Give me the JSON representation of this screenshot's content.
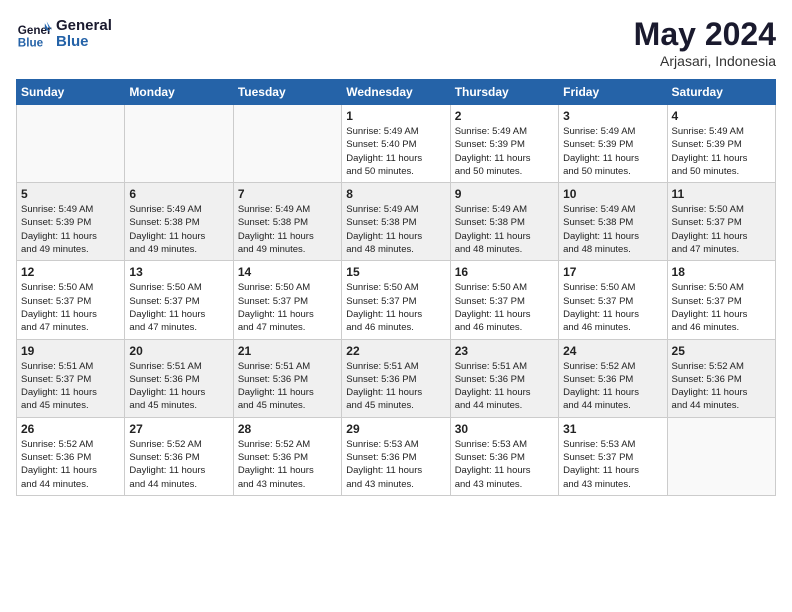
{
  "header": {
    "logo_line1": "General",
    "logo_line2": "Blue",
    "month": "May 2024",
    "location": "Arjasari, Indonesia"
  },
  "weekdays": [
    "Sunday",
    "Monday",
    "Tuesday",
    "Wednesday",
    "Thursday",
    "Friday",
    "Saturday"
  ],
  "weeks": [
    [
      {
        "day": "",
        "info": ""
      },
      {
        "day": "",
        "info": ""
      },
      {
        "day": "",
        "info": ""
      },
      {
        "day": "1",
        "info": "Sunrise: 5:49 AM\nSunset: 5:40 PM\nDaylight: 11 hours\nand 50 minutes."
      },
      {
        "day": "2",
        "info": "Sunrise: 5:49 AM\nSunset: 5:39 PM\nDaylight: 11 hours\nand 50 minutes."
      },
      {
        "day": "3",
        "info": "Sunrise: 5:49 AM\nSunset: 5:39 PM\nDaylight: 11 hours\nand 50 minutes."
      },
      {
        "day": "4",
        "info": "Sunrise: 5:49 AM\nSunset: 5:39 PM\nDaylight: 11 hours\nand 50 minutes."
      }
    ],
    [
      {
        "day": "5",
        "info": "Sunrise: 5:49 AM\nSunset: 5:39 PM\nDaylight: 11 hours\nand 49 minutes."
      },
      {
        "day": "6",
        "info": "Sunrise: 5:49 AM\nSunset: 5:38 PM\nDaylight: 11 hours\nand 49 minutes."
      },
      {
        "day": "7",
        "info": "Sunrise: 5:49 AM\nSunset: 5:38 PM\nDaylight: 11 hours\nand 49 minutes."
      },
      {
        "day": "8",
        "info": "Sunrise: 5:49 AM\nSunset: 5:38 PM\nDaylight: 11 hours\nand 48 minutes."
      },
      {
        "day": "9",
        "info": "Sunrise: 5:49 AM\nSunset: 5:38 PM\nDaylight: 11 hours\nand 48 minutes."
      },
      {
        "day": "10",
        "info": "Sunrise: 5:49 AM\nSunset: 5:38 PM\nDaylight: 11 hours\nand 48 minutes."
      },
      {
        "day": "11",
        "info": "Sunrise: 5:50 AM\nSunset: 5:37 PM\nDaylight: 11 hours\nand 47 minutes."
      }
    ],
    [
      {
        "day": "12",
        "info": "Sunrise: 5:50 AM\nSunset: 5:37 PM\nDaylight: 11 hours\nand 47 minutes."
      },
      {
        "day": "13",
        "info": "Sunrise: 5:50 AM\nSunset: 5:37 PM\nDaylight: 11 hours\nand 47 minutes."
      },
      {
        "day": "14",
        "info": "Sunrise: 5:50 AM\nSunset: 5:37 PM\nDaylight: 11 hours\nand 47 minutes."
      },
      {
        "day": "15",
        "info": "Sunrise: 5:50 AM\nSunset: 5:37 PM\nDaylight: 11 hours\nand 46 minutes."
      },
      {
        "day": "16",
        "info": "Sunrise: 5:50 AM\nSunset: 5:37 PM\nDaylight: 11 hours\nand 46 minutes."
      },
      {
        "day": "17",
        "info": "Sunrise: 5:50 AM\nSunset: 5:37 PM\nDaylight: 11 hours\nand 46 minutes."
      },
      {
        "day": "18",
        "info": "Sunrise: 5:50 AM\nSunset: 5:37 PM\nDaylight: 11 hours\nand 46 minutes."
      }
    ],
    [
      {
        "day": "19",
        "info": "Sunrise: 5:51 AM\nSunset: 5:37 PM\nDaylight: 11 hours\nand 45 minutes."
      },
      {
        "day": "20",
        "info": "Sunrise: 5:51 AM\nSunset: 5:36 PM\nDaylight: 11 hours\nand 45 minutes."
      },
      {
        "day": "21",
        "info": "Sunrise: 5:51 AM\nSunset: 5:36 PM\nDaylight: 11 hours\nand 45 minutes."
      },
      {
        "day": "22",
        "info": "Sunrise: 5:51 AM\nSunset: 5:36 PM\nDaylight: 11 hours\nand 45 minutes."
      },
      {
        "day": "23",
        "info": "Sunrise: 5:51 AM\nSunset: 5:36 PM\nDaylight: 11 hours\nand 44 minutes."
      },
      {
        "day": "24",
        "info": "Sunrise: 5:52 AM\nSunset: 5:36 PM\nDaylight: 11 hours\nand 44 minutes."
      },
      {
        "day": "25",
        "info": "Sunrise: 5:52 AM\nSunset: 5:36 PM\nDaylight: 11 hours\nand 44 minutes."
      }
    ],
    [
      {
        "day": "26",
        "info": "Sunrise: 5:52 AM\nSunset: 5:36 PM\nDaylight: 11 hours\nand 44 minutes."
      },
      {
        "day": "27",
        "info": "Sunrise: 5:52 AM\nSunset: 5:36 PM\nDaylight: 11 hours\nand 44 minutes."
      },
      {
        "day": "28",
        "info": "Sunrise: 5:52 AM\nSunset: 5:36 PM\nDaylight: 11 hours\nand 43 minutes."
      },
      {
        "day": "29",
        "info": "Sunrise: 5:53 AM\nSunset: 5:36 PM\nDaylight: 11 hours\nand 43 minutes."
      },
      {
        "day": "30",
        "info": "Sunrise: 5:53 AM\nSunset: 5:36 PM\nDaylight: 11 hours\nand 43 minutes."
      },
      {
        "day": "31",
        "info": "Sunrise: 5:53 AM\nSunset: 5:37 PM\nDaylight: 11 hours\nand 43 minutes."
      },
      {
        "day": "",
        "info": ""
      }
    ]
  ]
}
